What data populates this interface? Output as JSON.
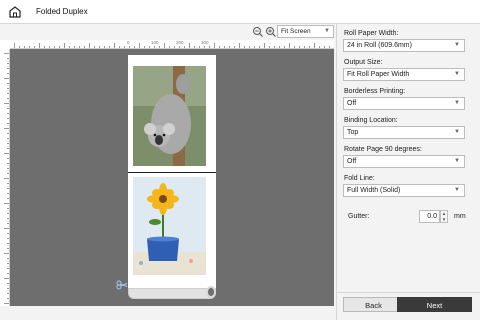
{
  "window": {
    "title": "Folded Duplex",
    "home_icon": "home-icon"
  },
  "preview": {
    "zoom_options_selected": "Fit Screen",
    "ruler_labels": [
      "0",
      "100",
      "200",
      "300"
    ],
    "background_color": "#6e6e6e"
  },
  "settings": {
    "roll_paper_width": {
      "label": "Roll Paper Width:",
      "value": "24 in Roll (609.6mm)"
    },
    "output_size": {
      "label": "Output Size:",
      "value": "Fit Roll Paper Width"
    },
    "borderless_printing": {
      "label": "Borderless Printing:",
      "value": "Off"
    },
    "binding_location": {
      "label": "Binding Location:",
      "value": "Top"
    },
    "rotate_page": {
      "label": "Rotate Page 90 degrees:",
      "value": "Off"
    },
    "fold_line": {
      "label": "Fold Line:",
      "value": "Full Width (Solid)"
    },
    "gutter": {
      "label": "Gutter:",
      "value": "0.0",
      "unit": "mm"
    }
  },
  "buttons": {
    "back": "Back",
    "next": "Next"
  },
  "colors": {
    "accent": "#3a3a3a",
    "panel_bg": "#f3f3f3"
  }
}
